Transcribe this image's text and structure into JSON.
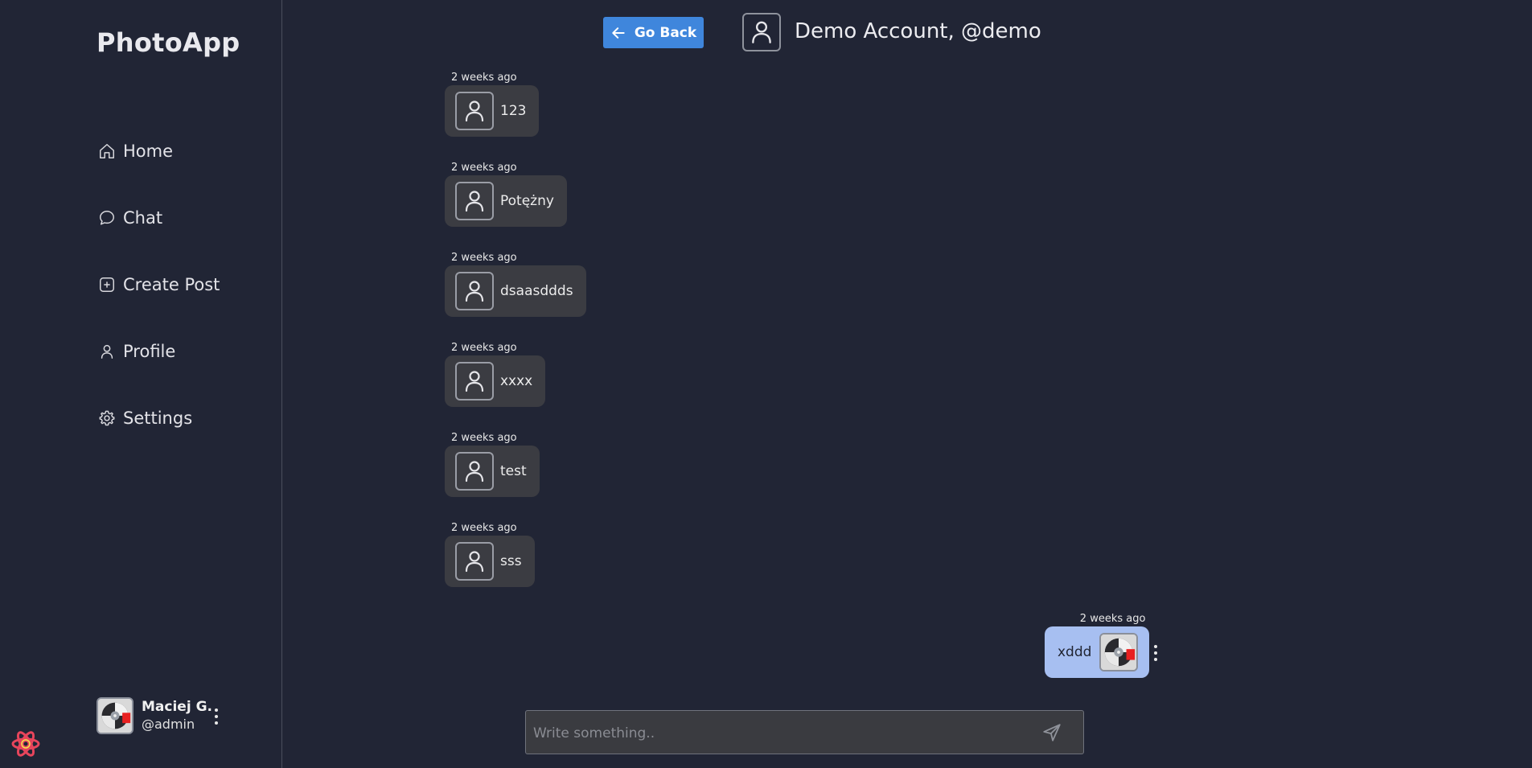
{
  "app": {
    "brand": "PhotoApp"
  },
  "sidebar": {
    "items": [
      {
        "label": "Home",
        "icon": "home-icon"
      },
      {
        "label": "Chat",
        "icon": "chat-bubble-icon"
      },
      {
        "label": "Create Post",
        "icon": "plus-square-icon"
      },
      {
        "label": "Profile",
        "icon": "user-icon"
      },
      {
        "label": "Settings",
        "icon": "gear-icon"
      }
    ],
    "user": {
      "name": "Maciej G.",
      "handle": "@admin"
    }
  },
  "header": {
    "back_label": "Go Back",
    "title": "Demo Account, @demo"
  },
  "messages": [
    {
      "time": "2 weeks ago",
      "text": "123"
    },
    {
      "time": "2 weeks ago",
      "text": "Potężny"
    },
    {
      "time": "2 weeks ago",
      "text": "dsaasddds"
    },
    {
      "time": "2 weeks ago",
      "text": "xxxx"
    },
    {
      "time": "2 weeks ago",
      "text": "test"
    },
    {
      "time": "2 weeks ago",
      "text": "sss"
    }
  ],
  "my_message": {
    "time": "2 weeks ago",
    "text": "xddd"
  },
  "composer": {
    "placeholder": "Write something.."
  },
  "colors": {
    "background": "#212535",
    "accent": "#3f86dc",
    "bubble_other": "#3b3c42",
    "bubble_mine": "#a7bff1"
  }
}
